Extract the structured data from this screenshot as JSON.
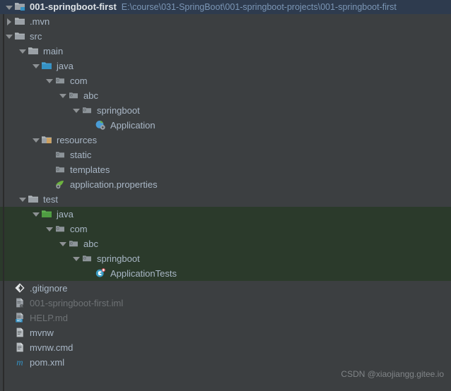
{
  "window": {
    "background": "#3c3f41",
    "header_background": "#2e3b4e",
    "selection_green": "#2b3a2b",
    "text_color": "#a9b7c6",
    "path_color": "#7b96b5"
  },
  "header": {
    "twisty": "expanded",
    "icon": "module-folder-icon",
    "name": "001-springboot-first",
    "path": "E:\\course\\031-SpringBoot\\001-springboot-projects\\001-springboot-first"
  },
  "tree": {
    "rows": [
      {
        "depth": 1,
        "twisty": "collapsed",
        "icon": "folder-icon",
        "label": ".mvn",
        "dim": false,
        "selected": false
      },
      {
        "depth": 1,
        "twisty": "expanded",
        "icon": "folder-icon",
        "label": "src",
        "dim": false,
        "selected": false
      },
      {
        "depth": 2,
        "twisty": "expanded",
        "icon": "folder-icon",
        "label": "main",
        "dim": false,
        "selected": false
      },
      {
        "depth": 3,
        "twisty": "expanded",
        "icon": "source-root-icon",
        "label": "java",
        "dim": false,
        "selected": false
      },
      {
        "depth": 4,
        "twisty": "expanded",
        "icon": "package-icon",
        "label": "com",
        "dim": false,
        "selected": false
      },
      {
        "depth": 5,
        "twisty": "expanded",
        "icon": "package-icon",
        "label": "abc",
        "dim": false,
        "selected": false
      },
      {
        "depth": 6,
        "twisty": "expanded",
        "icon": "package-icon",
        "label": "springboot",
        "dim": false,
        "selected": false
      },
      {
        "depth": 7,
        "twisty": "none",
        "icon": "springboot-class-icon",
        "label": "Application",
        "dim": false,
        "selected": false
      },
      {
        "depth": 3,
        "twisty": "expanded",
        "icon": "resource-root-icon",
        "label": "resources",
        "dim": false,
        "selected": false
      },
      {
        "depth": 4,
        "twisty": "none",
        "icon": "package-icon",
        "label": "static",
        "dim": false,
        "selected": false
      },
      {
        "depth": 4,
        "twisty": "none",
        "icon": "package-icon",
        "label": "templates",
        "dim": false,
        "selected": false
      },
      {
        "depth": 4,
        "twisty": "none",
        "icon": "properties-file-icon",
        "label": "application.properties",
        "dim": false,
        "selected": false
      },
      {
        "depth": 2,
        "twisty": "expanded",
        "icon": "folder-icon",
        "label": "test",
        "dim": false,
        "selected": false
      },
      {
        "depth": 3,
        "twisty": "expanded",
        "icon": "test-source-root-icon",
        "label": "java",
        "dim": false,
        "selected": true
      },
      {
        "depth": 4,
        "twisty": "expanded",
        "icon": "package-icon",
        "label": "com",
        "dim": false,
        "selected": true
      },
      {
        "depth": 5,
        "twisty": "expanded",
        "icon": "package-icon",
        "label": "abc",
        "dim": false,
        "selected": true
      },
      {
        "depth": 6,
        "twisty": "expanded",
        "icon": "package-icon",
        "label": "springboot",
        "dim": false,
        "selected": true
      },
      {
        "depth": 7,
        "twisty": "none",
        "icon": "test-class-icon",
        "label": "ApplicationTests",
        "dim": false,
        "selected": true
      },
      {
        "depth": 1,
        "twisty": "none",
        "icon": "gitignore-icon",
        "label": ".gitignore",
        "dim": false,
        "selected": false
      },
      {
        "depth": 1,
        "twisty": "none",
        "icon": "iml-file-icon",
        "label": "001-springboot-first.iml",
        "dim": true,
        "selected": false
      },
      {
        "depth": 1,
        "twisty": "none",
        "icon": "markdown-file-icon",
        "label": "HELP.md",
        "dim": true,
        "selected": false
      },
      {
        "depth": 1,
        "twisty": "none",
        "icon": "text-file-icon",
        "label": "mvnw",
        "dim": false,
        "selected": false
      },
      {
        "depth": 1,
        "twisty": "none",
        "icon": "text-file-icon",
        "label": "mvnw.cmd",
        "dim": false,
        "selected": false
      },
      {
        "depth": 1,
        "twisty": "none",
        "icon": "maven-file-icon",
        "label": "pom.xml",
        "dim": false,
        "selected": false
      }
    ]
  },
  "watermark": {
    "text": "CSDN @xiaojiangg.gitee.io"
  }
}
